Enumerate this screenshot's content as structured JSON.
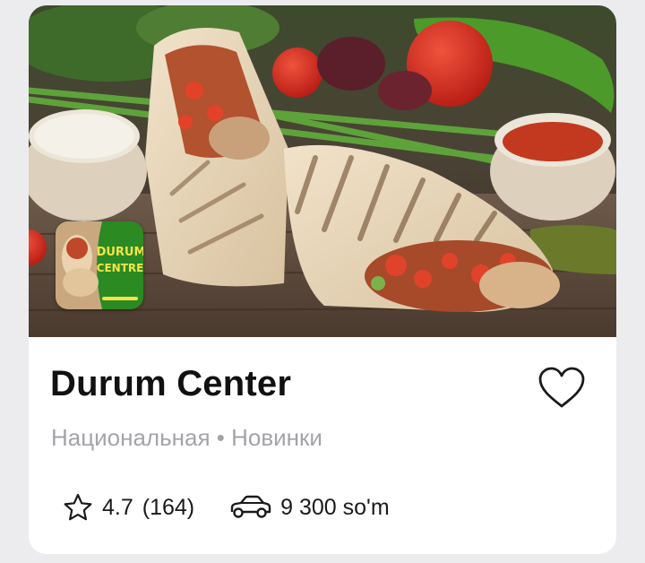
{
  "restaurant": {
    "name": "Durum Center",
    "tags": "Национальная • Новинки",
    "rating": "4.7",
    "reviews": "(164)",
    "delivery_price": "9 300 so'm",
    "logo_text": "DURUM CENTRE"
  },
  "icons": {
    "favorite": "heart-outline-icon",
    "rating": "star-outline-icon",
    "delivery": "car-icon"
  },
  "colors": {
    "logo_green": "#2b8a22",
    "text_primary": "#111111",
    "text_secondary": "#a3a3aa"
  }
}
